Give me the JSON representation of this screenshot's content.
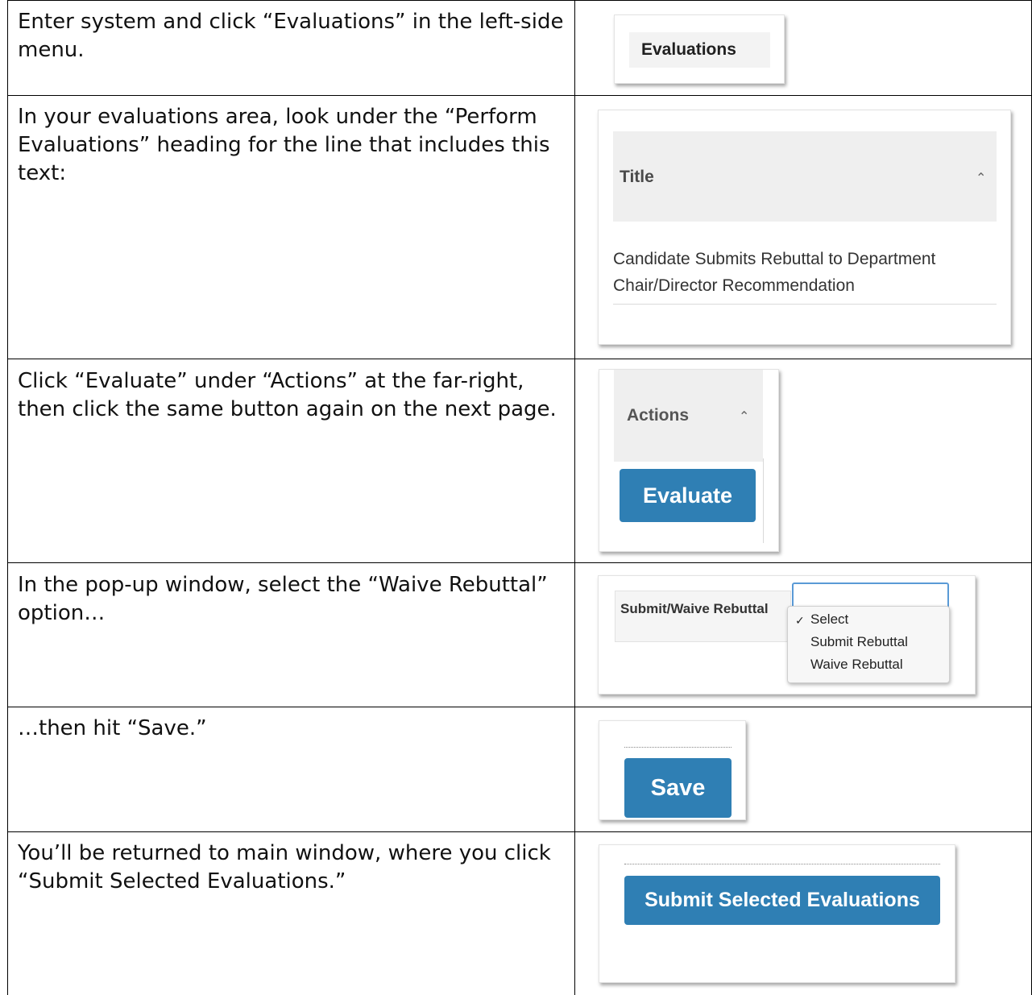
{
  "steps": [
    {
      "text": "Enter system and click “Evaluations” in the left-side menu."
    },
    {
      "text": "In your evaluations area, look under the “Perform Evaluations” heading for the line that includes this text:"
    },
    {
      "text": "Click “Evaluate” under “Actions” at the far-right, then click the same button again on the next page."
    },
    {
      "text": "In the pop-up window, select the “Waive Rebuttal” option…"
    },
    {
      "text": "…then hit “Save.”"
    },
    {
      "text": "You’ll be returned to main window, where you click “Submit Selected Evaluations.”"
    }
  ],
  "screens": {
    "menu": {
      "item_label": "Evaluations"
    },
    "table": {
      "column_header": "Title",
      "row_text": "Candidate Submits Rebuttal to Department Chair/Director Recommendation"
    },
    "actions": {
      "column_header": "Actions",
      "button_label": "Evaluate"
    },
    "rebuttal": {
      "field_label": "Submit/Waive Rebuttal",
      "options": [
        "Select",
        "Submit Rebuttal",
        "Waive Rebuttal"
      ]
    },
    "save": {
      "button_label": "Save"
    },
    "submit": {
      "button_label": "Submit Selected Evaluations"
    }
  },
  "colors": {
    "button": "#2f7fb4",
    "header_bg": "#efefef",
    "border": "#000000"
  },
  "icons": {
    "sort": "caret-up-icon",
    "selected": "checkmark-icon"
  }
}
